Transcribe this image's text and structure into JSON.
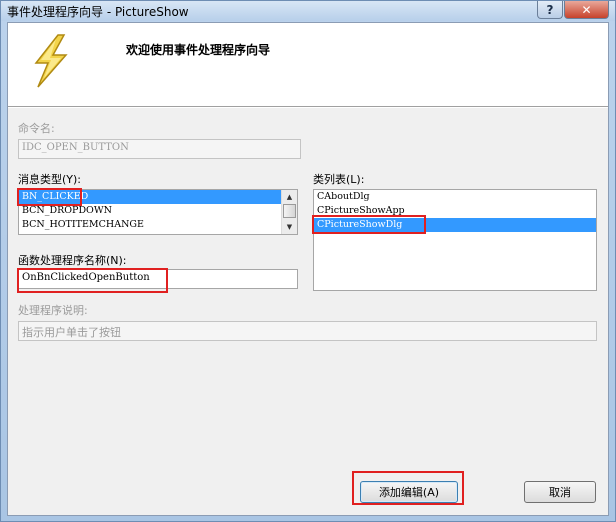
{
  "window": {
    "title": "事件处理程序向导 - PictureShow",
    "help_glyph": "?",
    "close_glyph": "✕"
  },
  "header": {
    "title": "欢迎使用事件处理程序向导",
    "icon": "lightning-bolt-icon"
  },
  "command_name": {
    "label": "命令名:",
    "value": "IDC_OPEN_BUTTON"
  },
  "message_type": {
    "label": "消息类型(Y):",
    "items": [
      "BN_CLICKED",
      "BCN_DROPDOWN",
      "BCN_HOTITEMCHANGE"
    ],
    "selected_index": 0
  },
  "class_list": {
    "label": "类列表(L):",
    "items": [
      "CAboutDlg",
      "CPictureShowApp",
      "CPictureShowDlg"
    ],
    "selected_index": 2
  },
  "handler_name": {
    "label": "函数处理程序名称(N):",
    "value": "OnBnClickedOpenButton"
  },
  "handler_description": {
    "label": "处理程序说明:",
    "value": "指示用户单击了按钮"
  },
  "buttons": {
    "add_edit": "添加编辑(A)",
    "cancel": "取消"
  },
  "colors": {
    "selection": "#3399ff",
    "highlight_box": "#e02020"
  }
}
